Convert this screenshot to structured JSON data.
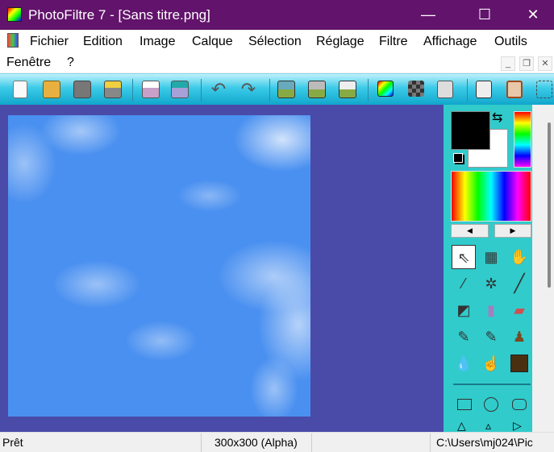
{
  "window": {
    "title": "PhotoFiltre 7 - [Sans titre.png]",
    "minimize": "—",
    "maximize": "☐",
    "close": "✕"
  },
  "menu": [
    "Fichier",
    "Edition",
    "Image",
    "Calque",
    "Sélection",
    "Réglage",
    "Filtre",
    "Affichage",
    "Outils",
    "Fenêtre",
    "?"
  ],
  "mdi": {
    "minimize": "_",
    "restore": "❐",
    "close": "✕"
  },
  "toolbar": [
    "new-icon",
    "open-icon",
    "save-icon",
    "save-as-icon",
    "print-icon",
    "scan-icon",
    "undo-icon",
    "redo-icon",
    "image-copy-icon",
    "transparent-copy-icon",
    "duplicate-icon",
    "gradient-icon",
    "mosaic-icon",
    "automation-icon",
    "batch-icon",
    "frame-icon",
    "selection-icon"
  ],
  "colors": {
    "foreground": "#000000",
    "background": "#ffffff",
    "workspace": "#4a4aa8",
    "panel": "#31cbcb",
    "titlebar": "#62136b",
    "canvas": "#4a90f0"
  },
  "tools": [
    "pointer",
    "pattern",
    "hand",
    "eyedropper",
    "magic-wand",
    "line",
    "bucket",
    "spray",
    "eraser",
    "brush",
    "advanced-brush",
    "stamp",
    "blur-drop",
    "finger",
    "clone"
  ],
  "shapes": [
    "rectangle",
    "ellipse",
    "rounded-rectangle",
    "triangle-up",
    "triangle-narrow",
    "triangle-right"
  ],
  "status": {
    "state": "Prêt",
    "size": "300x300 (Alpha)",
    "path": "C:\\Users\\mj024\\Pic"
  }
}
